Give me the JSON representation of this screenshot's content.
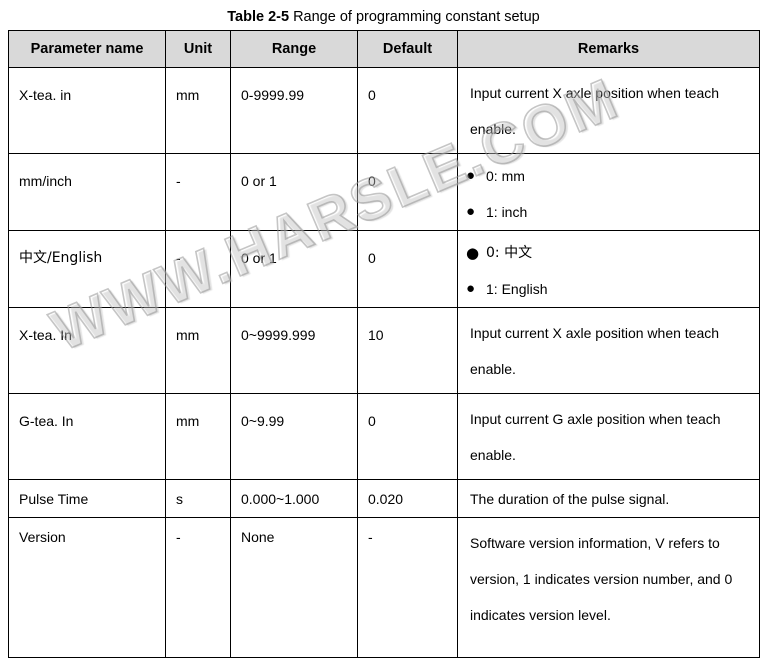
{
  "document": {
    "title_label": "Table 2-5",
    "title_text": " Range of programming constant setup"
  },
  "watermark": {
    "text": "WWW.HARSLE.COM"
  },
  "table": {
    "headers": [
      "Parameter name",
      "Unit",
      "Range",
      "Default",
      "Remarks"
    ],
    "rows": [
      {
        "name": "X-tea. in",
        "unit": "mm",
        "range": "0-9999.99",
        "default": "0",
        "remarks_type": "text",
        "remarks": "Input current X axle position when teach enable."
      },
      {
        "name": "mm/inch",
        "unit": "-",
        "range": "0 or 1",
        "default": "0",
        "remarks_type": "bullets",
        "remarks_bullets": [
          "0: mm",
          "1: inch"
        ]
      },
      {
        "name": "中文/English",
        "unit": "-",
        "range": "0 or 1",
        "default": "0",
        "remarks_type": "bullets",
        "remarks_bullets": [
          "0:  中文",
          "1: English"
        ]
      },
      {
        "name": "X-tea. In",
        "unit": "mm",
        "range": "0~9999.999",
        "default": "10",
        "remarks_type": "text",
        "remarks": "Input current X axle position when teach enable."
      },
      {
        "name": "G-tea. In",
        "unit": "mm",
        "range": "0~9.99",
        "default": "0",
        "remarks_type": "text",
        "remarks": "Input current G axle position when teach enable."
      },
      {
        "name": "Pulse Time",
        "unit": "s",
        "range": "0.000~1.000",
        "default": "0.020",
        "remarks_type": "text",
        "remarks": "The duration of the pulse signal."
      },
      {
        "name": "Version",
        "unit": "-",
        "range": "None",
        "default": "-",
        "remarks_type": "text",
        "remarks": "Software version information, V refers to version, 1 indicates version number, and 0 indicates version level."
      }
    ]
  },
  "colors": {
    "header_fill": "#d9d9d9",
    "border": "#000000",
    "text": "#000000",
    "watermark": "#c0c0c0"
  }
}
